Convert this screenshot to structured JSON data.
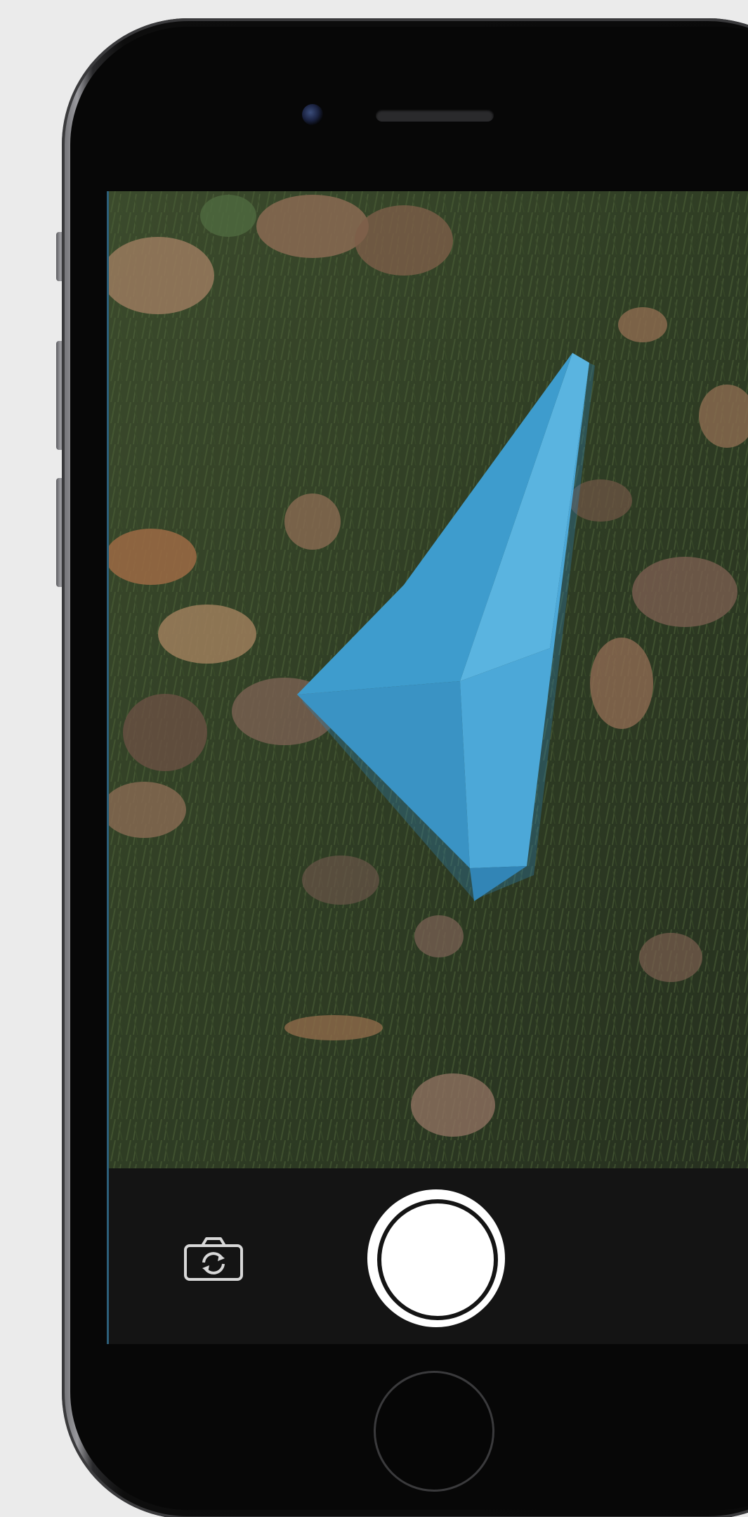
{
  "device": {
    "model_type": "smartphone",
    "frame_color": "#0a0a0a",
    "screen_accent": "#2c5f7a"
  },
  "camera_app": {
    "viewfinder_subject": "blue-paper-arrow-on-grass",
    "object_color": "#4aa8d8",
    "controls": {
      "switch_camera_icon": "camera-rotate-icon",
      "shutter_icon": "shutter-circle",
      "home_icon": "home-button-circle"
    }
  }
}
